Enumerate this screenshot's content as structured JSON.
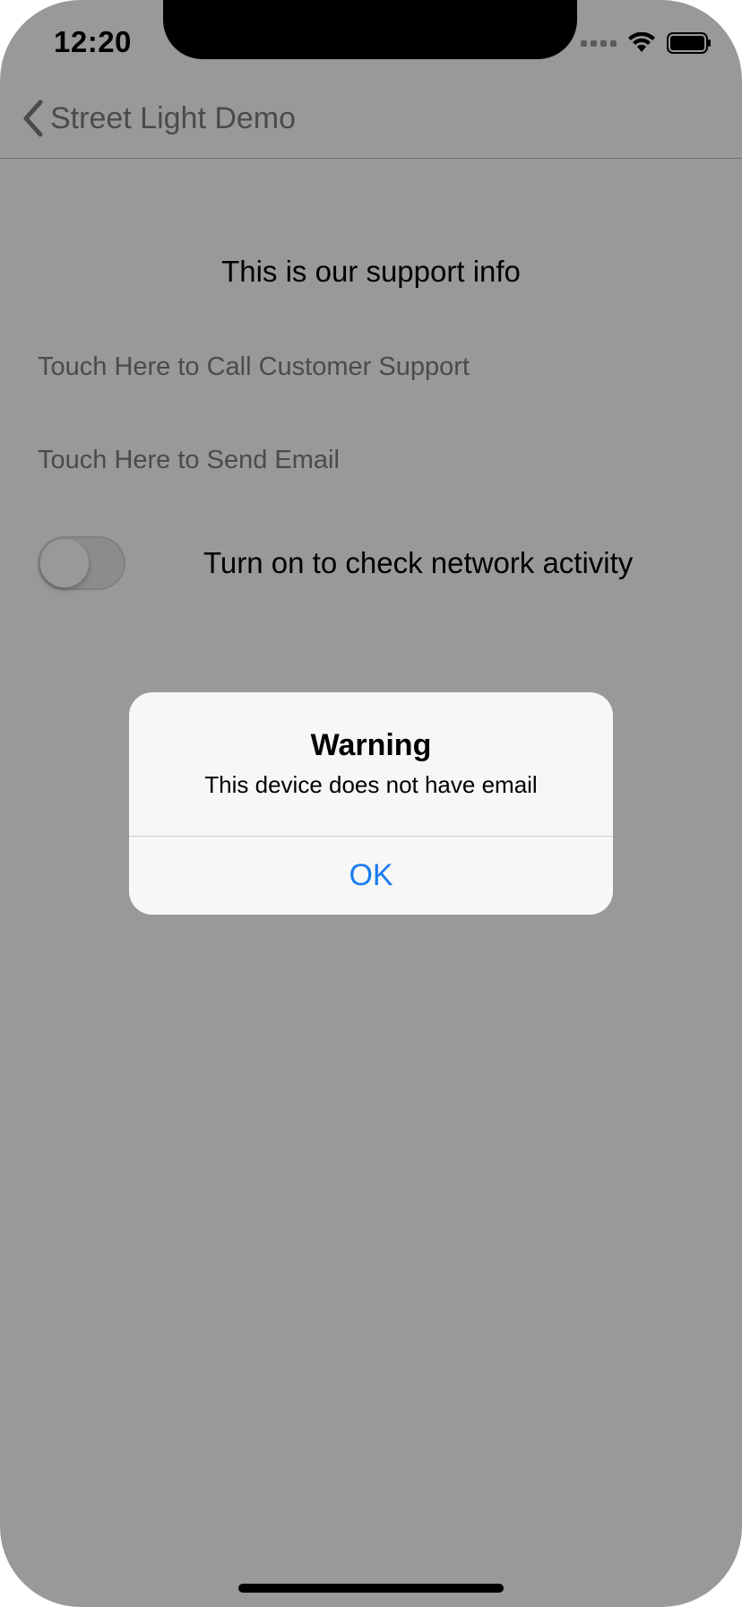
{
  "status_bar": {
    "time": "12:20"
  },
  "nav": {
    "back_label": "Street Light Demo"
  },
  "content": {
    "title": "This is our support info",
    "call_link": "Touch Here to Call Customer Support",
    "email_link": "Touch Here to Send Email",
    "toggle_label": "Turn on to check network activity",
    "toggle_on": false
  },
  "alert": {
    "title": "Warning",
    "message": "This device does not have email",
    "ok_label": "OK"
  },
  "colors": {
    "accent": "#1a7cf0",
    "overlay": "rgba(0,0,0,0.40)"
  },
  "icons": {
    "back": "chevron-left-icon",
    "wifi": "wifi-icon",
    "battery": "battery-icon",
    "signal": "signal-dots-icon"
  }
}
